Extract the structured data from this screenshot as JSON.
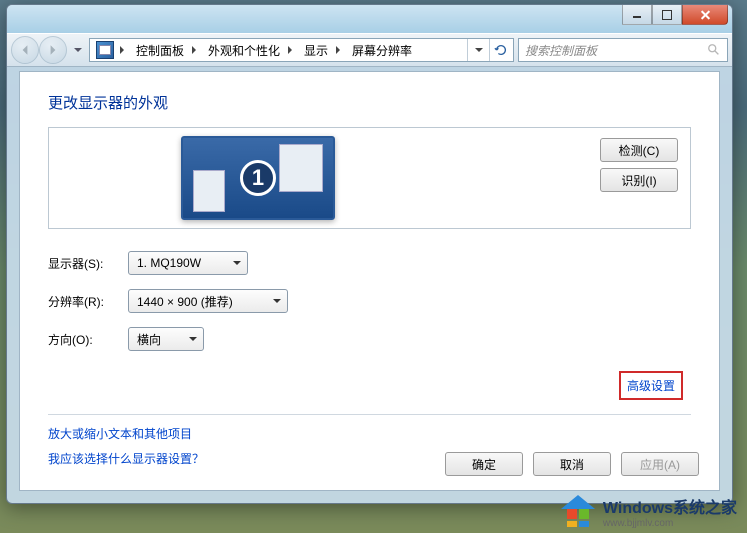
{
  "breadcrumbs": {
    "item0": "控制面板",
    "item1": "外观和个性化",
    "item2": "显示",
    "item3": "屏幕分辨率"
  },
  "search": {
    "placeholder": "搜索控制面板"
  },
  "page": {
    "heading": "更改显示器的外观",
    "monitor_number": "1",
    "detect_btn": "检测(C)",
    "identify_btn": "识别(I)"
  },
  "form": {
    "display_label": "显示器(S):",
    "display_value": "1. MQ190W",
    "resolution_label": "分辨率(R):",
    "resolution_value": "1440 × 900 (推荐)",
    "orientation_label": "方向(O):",
    "orientation_value": "横向"
  },
  "links": {
    "advanced": "高级设置",
    "zoom_text": "放大或缩小文本和其他项目",
    "which_display": "我应该选择什么显示器设置？"
  },
  "buttons": {
    "ok": "确定",
    "cancel": "取消",
    "apply": "应用(A)"
  },
  "watermark": {
    "brand": "Windows",
    "suffix": "系统之家",
    "url": "www.bjjmlv.com"
  }
}
